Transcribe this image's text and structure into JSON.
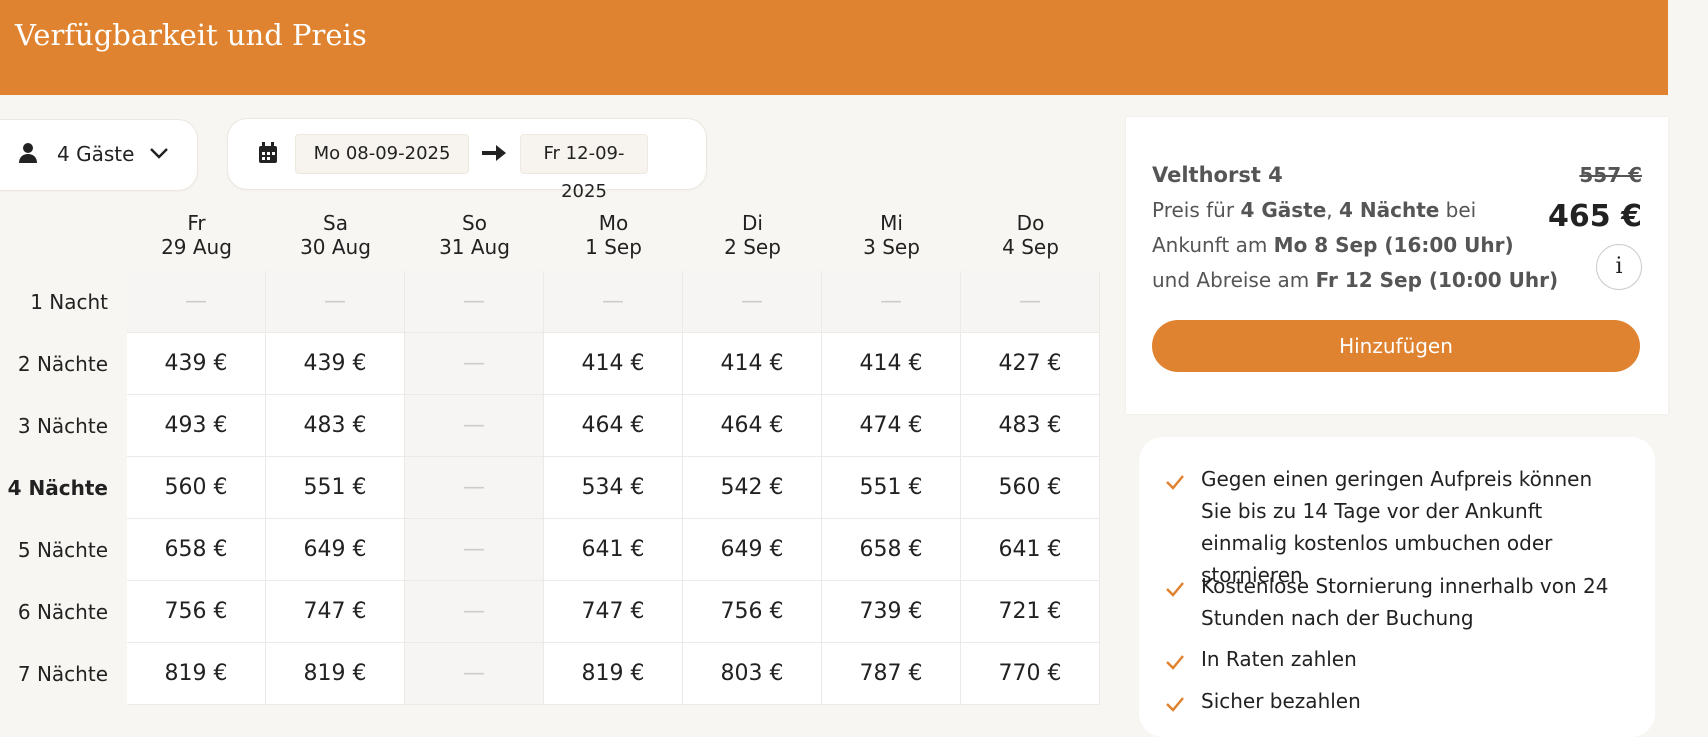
{
  "header": {
    "title": "Verfügbarkeit und Preis"
  },
  "guests": {
    "label": "4 Gäste",
    "icon": "person-icon"
  },
  "dates": {
    "checkin": "Mo 08-09-2025",
    "checkout": "Fr 12-09-2025"
  },
  "grid": {
    "columns": [
      {
        "day": "Fr",
        "date": "29 Aug"
      },
      {
        "day": "Sa",
        "date": "30 Aug"
      },
      {
        "day": "So",
        "date": "31 Aug"
      },
      {
        "day": "Mo",
        "date": "1 Sep"
      },
      {
        "day": "Di",
        "date": "2 Sep"
      },
      {
        "day": "Mi",
        "date": "3 Sep"
      },
      {
        "day": "Do",
        "date": "4 Sep"
      }
    ],
    "rows": [
      {
        "label": "1 Nacht",
        "values": [
          "—",
          "—",
          "—",
          "—",
          "—",
          "—",
          "—"
        ]
      },
      {
        "label": "2 Nächte",
        "values": [
          "439 €",
          "439 €",
          "—",
          "414 €",
          "414 €",
          "414 €",
          "427 €"
        ]
      },
      {
        "label": "3 Nächte",
        "values": [
          "493 €",
          "483 €",
          "—",
          "464 €",
          "464 €",
          "474 €",
          "483 €"
        ]
      },
      {
        "label": "4 Nächte",
        "values": [
          "560 €",
          "551 €",
          "—",
          "534 €",
          "542 €",
          "551 €",
          "560 €"
        ],
        "selected": true
      },
      {
        "label": "5 Nächte",
        "values": [
          "658 €",
          "649 €",
          "—",
          "641 €",
          "649 €",
          "658 €",
          "641 €"
        ]
      },
      {
        "label": "6 Nächte",
        "values": [
          "756 €",
          "747 €",
          "—",
          "747 €",
          "756 €",
          "739 €",
          "721 €"
        ]
      },
      {
        "label": "7 Nächte",
        "values": [
          "819 €",
          "819 €",
          "—",
          "819 €",
          "803 €",
          "787 €",
          "770 €"
        ]
      }
    ]
  },
  "summary": {
    "name": "Velthorst 4",
    "old_price": "557 €",
    "new_price": "465 €",
    "line1_pre": "Preis für ",
    "line1_guests": "4 Gäste",
    "line1_mid": ", ",
    "line1_nights": "4 Nächte",
    "line1_post": " bei",
    "line2_pre": "Ankunft am ",
    "line2_bold": "Mo 8 Sep (16:00 Uhr)",
    "line3_pre": "und Abreise am ",
    "line3_bold": "Fr 12 Sep (10:00 Uhr)",
    "info_label": "i",
    "add_label": "Hinzufügen"
  },
  "benefits": [
    "Gegen einen geringen Aufpreis können Sie bis zu 14 Tage vor der Ankunft einmalig kostenlos umbuchen oder stornieren",
    "Kostenlose Stornierung innerhalb von 24 Stunden nach der Buchung",
    "In Raten zahlen",
    "Sicher bezahlen"
  ],
  "colors": {
    "accent": "#e08330",
    "check": "#e08330"
  }
}
